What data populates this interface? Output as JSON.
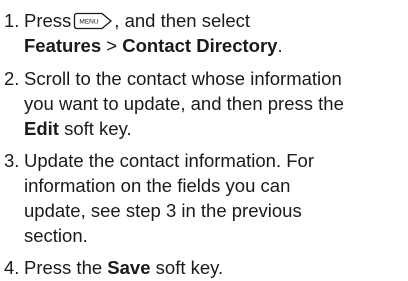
{
  "steps": [
    {
      "number": "1.",
      "line1_pre": "Press",
      "menu_key_label": "MENU",
      "line1_post": ", and then select",
      "features": "Features",
      "separator": " > ",
      "contact_directory": "Contact Directory",
      "period": "."
    },
    {
      "number": "2.",
      "line1": "Scroll to the contact whose information",
      "line2": "you want to update, and then press the",
      "edit": "Edit",
      "line3_post": " soft key."
    },
    {
      "number": "3.",
      "line1": "Update the contact information. For",
      "line2": "information on the fields you can",
      "line3": "update, see step 3 in the previous",
      "line4": "section."
    },
    {
      "number": "4.",
      "pre": "Press the ",
      "save": "Save",
      "post": " soft key."
    }
  ]
}
